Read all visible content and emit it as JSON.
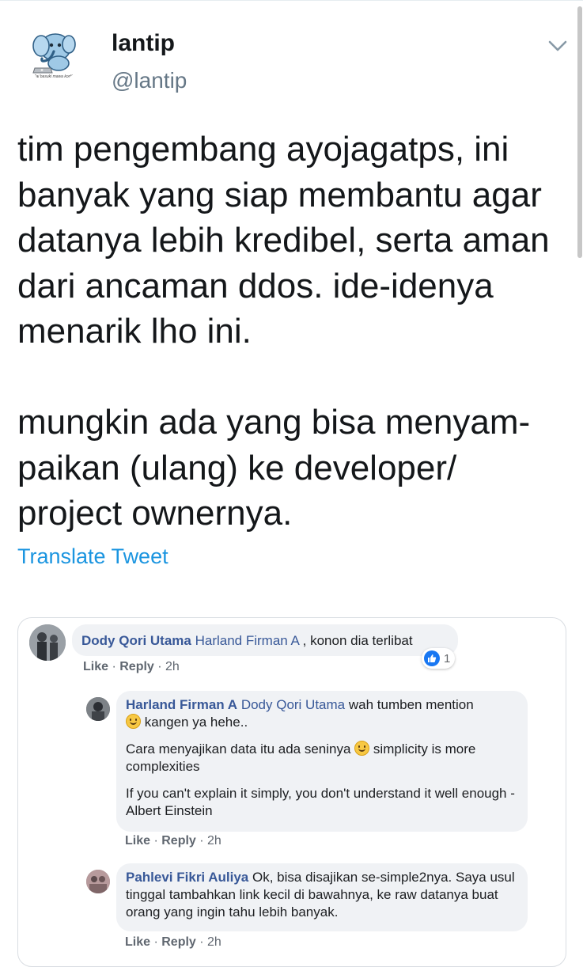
{
  "tweet": {
    "display_name": "lantip",
    "handle": "@lantip",
    "text": "tim pengembang ayojagatps, ini\nbanyak yang siap membantu agar\ndatanya lebih kredibel, serta aman\ndari ancaman ddos. ide-idenya\nmenarik lho ini.\n\nmungkin ada yang bisa menyam-\npaikan (ulang) ke developer/\nproject ownernya.",
    "translate_label": "Translate Tweet",
    "avatar_icon": "elephant-mascot-icon",
    "avatar_caption": "\"ai basuki mawa kodi\"",
    "menu_icon": "chevron-down-icon",
    "colors": {
      "link": "#1b95e0",
      "secondary": "#657786",
      "text": "#14171a"
    }
  },
  "facebook_comments": {
    "comment1": {
      "author": "Dody Qori Utama",
      "mention": "Harland Firman A",
      "text": " , konon dia terlibat",
      "like": "Like",
      "sep": " · ",
      "reply": "Reply",
      "time": "2h",
      "reaction_count": "1",
      "reaction_icon": "like-reaction-icon"
    },
    "reply1": {
      "author": "Harland Firman A",
      "mention": "Dody Qori Utama",
      "line1": " wah tumben mention",
      "line2": " kangen ya hehe..",
      "para2a": "Cara menyajikan data itu ada seninya ",
      "para2b": " simplicity is more complexities",
      "para3": "If you can't explain it simply, you don't understand it well enough -Albert Einstein",
      "like": "Like",
      "sep": " · ",
      "reply": "Reply",
      "time": "2h"
    },
    "reply2": {
      "author": "Pahlevi Fikri Auliya",
      "text": " Ok, bisa disajikan se-simple2nya. Saya usul tinggal tambahkan link kecil di bawahnya, ke raw datanya buat orang yang ingin tahu lebih banyak.",
      "like": "Like",
      "sep": " · ",
      "reply": "Reply",
      "time": "2h"
    },
    "colors": {
      "name": "#385898",
      "bubble": "#f0f2f5",
      "meta": "#606770",
      "like_blue": "#1877f2"
    }
  }
}
